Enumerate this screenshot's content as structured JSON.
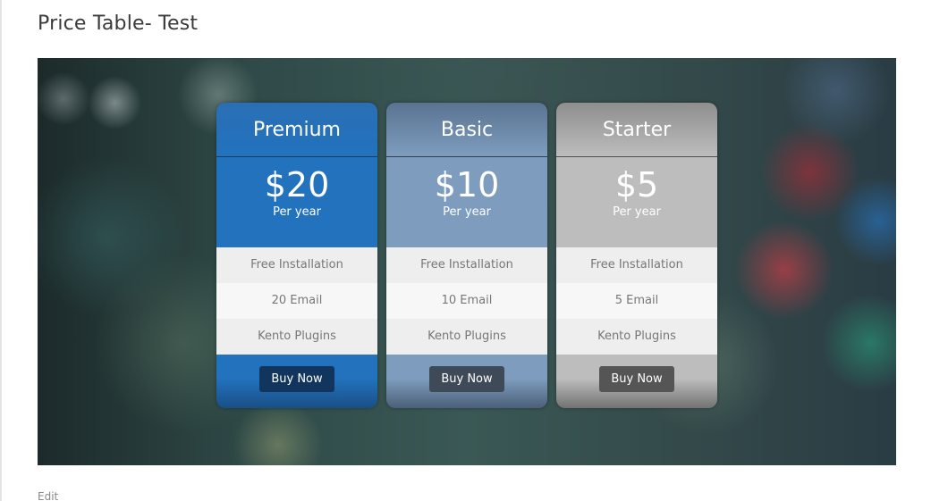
{
  "page": {
    "title": "Price Table- Test",
    "edit_label": "Edit"
  },
  "plans": [
    {
      "name": "Premium",
      "price": "$20",
      "period": "Per year",
      "features": [
        "Free Installation",
        "20 Email",
        "Kento Plugins"
      ],
      "button_label": "Buy Now",
      "color": "#2272bd"
    },
    {
      "name": "Basic",
      "price": "$10",
      "period": "Per year",
      "features": [
        "Free Installation",
        "10 Email",
        "Kento Plugins"
      ],
      "button_label": "Buy Now",
      "color": "#7e9dbe"
    },
    {
      "name": "Starter",
      "price": "$5",
      "period": "Per year",
      "features": [
        "Free Installation",
        "5 Email",
        "Kento Plugins"
      ],
      "button_label": "Buy Now",
      "color": "#bdbdbd"
    }
  ]
}
